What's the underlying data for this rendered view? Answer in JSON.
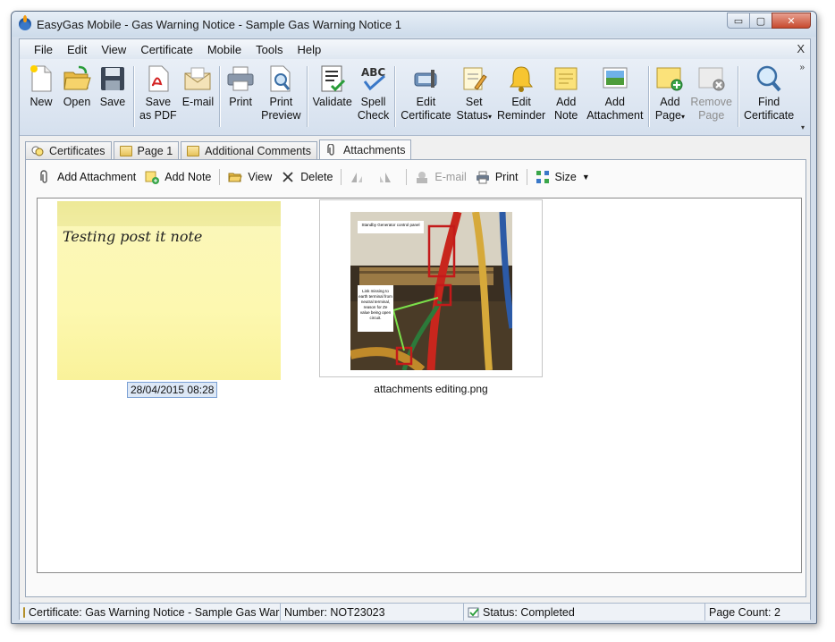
{
  "window": {
    "title": "EasyGas Mobile - Gas Warning Notice - Sample Gas Warning Notice 1",
    "controls": {
      "minimize": "▭",
      "maximize": "▢",
      "close": "✕"
    }
  },
  "menubar": {
    "items": [
      "File",
      "Edit",
      "View",
      "Certificate",
      "Mobile",
      "Tools",
      "Help"
    ],
    "close_glyph": "X"
  },
  "ribbon": {
    "more_glyph": "»",
    "overflow_glyph": "▾",
    "buttons": [
      {
        "label1": "New",
        "label2": "",
        "icon": "new-document-icon"
      },
      {
        "label1": "Open",
        "label2": "",
        "icon": "open-folder-icon"
      },
      {
        "label1": "Save",
        "label2": "",
        "icon": "save-disk-icon"
      },
      {
        "label1": "Save",
        "label2": "as PDF",
        "icon": "pdf-icon"
      },
      {
        "label1": "E-mail",
        "label2": "",
        "icon": "envelope-icon"
      },
      {
        "label1": "Print",
        "label2": "",
        "icon": "printer-icon"
      },
      {
        "label1": "Print",
        "label2": "Preview",
        "icon": "print-preview-icon"
      },
      {
        "label1": "Validate",
        "label2": "",
        "icon": "checklist-icon"
      },
      {
        "label1": "Spell",
        "label2": "Check",
        "icon": "abc-check-icon"
      },
      {
        "label1": "Edit",
        "label2": "Certificate",
        "icon": "edit-certificate-icon"
      },
      {
        "label1": "Set",
        "label2": "Status",
        "icon": "set-status-icon"
      },
      {
        "label1": "Edit",
        "label2": "Reminder",
        "icon": "bell-icon"
      },
      {
        "label1": "Add",
        "label2": "Note",
        "icon": "sticky-note-icon"
      },
      {
        "label1": "Add",
        "label2": "Attachment",
        "icon": "picture-icon"
      },
      {
        "label1": "Add",
        "label2": "Page",
        "icon": "add-page-icon"
      },
      {
        "label1": "Remove",
        "label2": "Page",
        "icon": "remove-page-icon"
      },
      {
        "label1": "Find",
        "label2": "Certificate",
        "icon": "magnifier-icon"
      }
    ]
  },
  "tabs": [
    {
      "label": "Certificates",
      "icon": "certificates-icon"
    },
    {
      "label": "Page 1",
      "icon": "folder-icon"
    },
    {
      "label": "Additional Comments",
      "icon": "folder-icon"
    },
    {
      "label": "Attachments",
      "icon": "paperclip-icon",
      "active": true
    }
  ],
  "subtoolbar": {
    "add_attachment": "Add Attachment",
    "add_note": "Add Note",
    "view": "View",
    "delete": "Delete",
    "email": "E-mail",
    "print": "Print",
    "size": "Size"
  },
  "attachments": {
    "note": {
      "text": "Testing post it note",
      "caption": "28/04/2015 08:28"
    },
    "image": {
      "caption": "attachments editing.png",
      "photo_label_top": "Standby Generator control panel",
      "photo_label_mid": "Link missing to earth terminal from neutral terminal, reason for Ze value being open circuit."
    }
  },
  "statusbar": {
    "certificate": "Certificate: Gas Warning Notice - Sample Gas Warn",
    "number": "Number: NOT23023",
    "status": "Status: Completed",
    "page_count": "Page Count: 2"
  },
  "colors": {
    "accent": "#3a78c8",
    "note_yellow": "#fdf8b0",
    "close_red": "#c74a2e"
  }
}
